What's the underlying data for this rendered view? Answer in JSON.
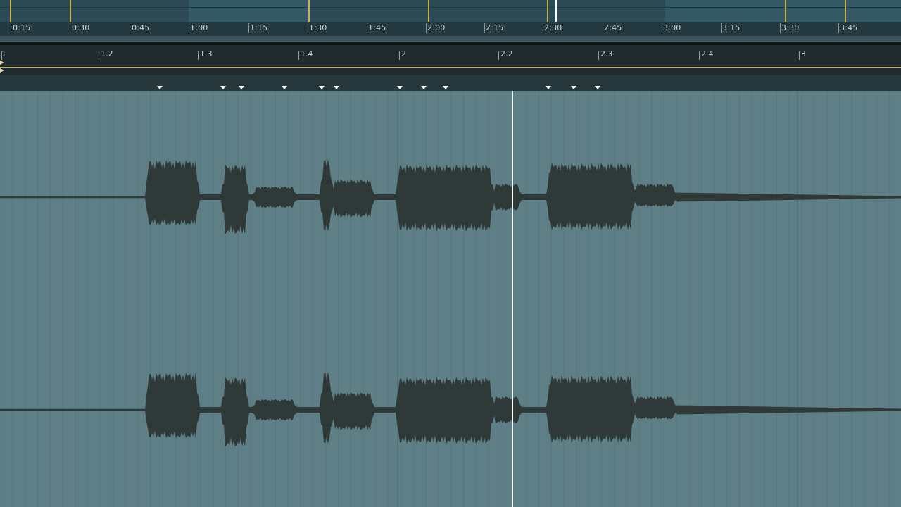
{
  "overview_time_labels": [
    "0:15",
    "0:30",
    "0:45",
    "1:00",
    "1:15",
    "1:30",
    "1:45",
    "2:00",
    "2:15",
    "2:30",
    "2:45",
    "3:00",
    "3:15",
    "3:30",
    "3:45"
  ],
  "beat_labels": [
    "1",
    "1.2",
    "1.3",
    "1.4",
    "2",
    "2.2",
    "2.3",
    "2.4",
    "3"
  ],
  "colors": {
    "waveform": "#2f3a38",
    "background": "#5f7f87",
    "playhead": "#ffffff",
    "loop_accent": "#c9b04a",
    "ruler": "#1f2b2f"
  },
  "icons": [
    "warp-marker-icon",
    "loop-brace-icon",
    "playhead-icon"
  ]
}
